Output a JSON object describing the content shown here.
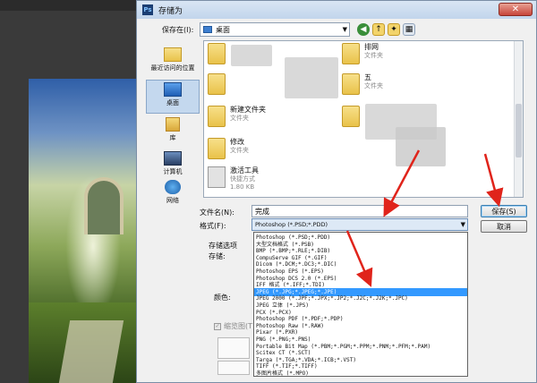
{
  "dialog": {
    "title": "存储为",
    "close_glyph": "✕",
    "logo": "Ps"
  },
  "savein": {
    "label": "保存在(I):",
    "value": "桌面",
    "arrow": "▼"
  },
  "nav_icons": [
    "back-icon",
    "up-folder-icon",
    "new-folder-icon",
    "view-menu-icon"
  ],
  "places": [
    {
      "label": "最近访问的位置",
      "icon": "recent-places-icon"
    },
    {
      "label": "桌面",
      "icon": "desktop-icon",
      "selected": true
    },
    {
      "label": "库",
      "icon": "libraries-icon"
    },
    {
      "label": "计算机",
      "icon": "computer-icon"
    },
    {
      "label": "网络",
      "icon": "network-icon"
    }
  ],
  "files": [
    {
      "name": "新建文件夹",
      "sub": "文件夹",
      "icon": "folder-icon"
    },
    {
      "name": "修改",
      "sub": "文件夹",
      "icon": "folder-icon"
    },
    {
      "name": "激活工具",
      "sub": "快捷方式",
      "sub2": "1.80 KB",
      "icon": "shortcut-icon"
    },
    {
      "name": "排网",
      "sub": "文件夹",
      "icon": "folder-icon"
    },
    {
      "name": "五",
      "sub": "文件夹",
      "icon": "folder-icon"
    }
  ],
  "filename": {
    "label": "文件名(N):",
    "value": "完成"
  },
  "format": {
    "label": "格式(F):",
    "value": "Photoshop (*.PSD;*.PDD)",
    "arrow": "▼"
  },
  "buttons": {
    "save": "保存(S)",
    "cancel": "取消"
  },
  "options": {
    "save_options": "存储选项",
    "save": "存储:",
    "color": "颜色:",
    "thumbnail": "缩览图(T)"
  },
  "format_options": [
    "Photoshop (*.PSD;*.PDD)",
    "大型文档格式 (*.PSB)",
    "BMP (*.BMP;*.RLE;*.DIB)",
    "CompuServe GIF (*.GIF)",
    "Dicom (*.DCM;*.DC3;*.DIC)",
    "Photoshop EPS (*.EPS)",
    "Photoshop DCS 2.0 (*.EPS)",
    "IFF 格式 (*.IFF;*.TDI)",
    "JPEG (*.JPG;*.JPEG;*.JPE)",
    "JPEG 2000 (*.JPF;*.JPX;*.JP2;*.J2C;*.J2K;*.JPC)",
    "JPEG 立体 (*.JPS)",
    "PCX (*.PCX)",
    "Photoshop PDF (*.PDF;*.PDP)",
    "Photoshop Raw (*.RAW)",
    "Pixar (*.PXR)",
    "PNG (*.PNG;*.PNS)",
    "Portable Bit Map (*.PBM;*.PGM;*.PPM;*.PNM;*.PFM;*.PAM)",
    "Scitex CT (*.SCT)",
    "Targa (*.TGA;*.VDA;*.ICB;*.VST)",
    "TIFF (*.TIF;*.TIFF)",
    "多图片格式 (*.MPO)"
  ],
  "selected_format_index": 8,
  "colors": {
    "selection": "#3399ff",
    "annotation": "#e0241b",
    "titlebar": "#c2d5ec"
  }
}
